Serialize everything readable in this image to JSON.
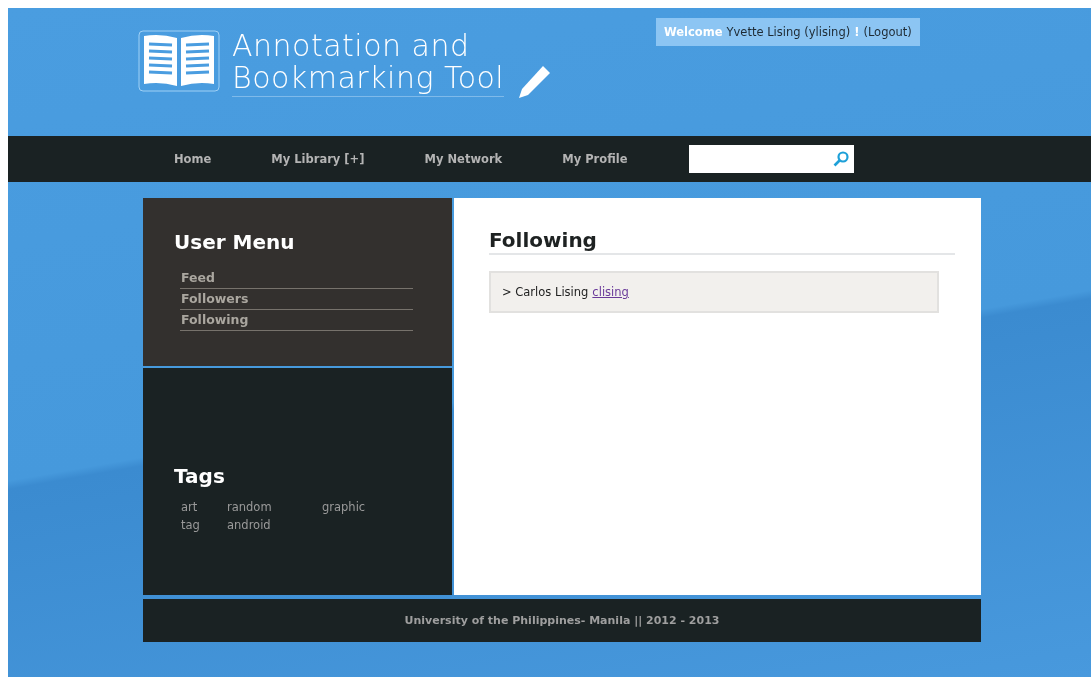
{
  "logo": {
    "title_lines": [
      "Annotation and",
      "Bookmarking Tool"
    ]
  },
  "welcome": {
    "greeting": "Welcome",
    "user": "Yvette Lising (ylising)",
    "mark": "!",
    "logout": "(Logout)"
  },
  "nav": {
    "items": [
      {
        "label": "Home"
      },
      {
        "label": "My Library [+]"
      },
      {
        "label": "My Network"
      },
      {
        "label": "My Profile"
      }
    ]
  },
  "user_menu": {
    "title": "User Menu",
    "items": [
      {
        "label": "Feed"
      },
      {
        "label": "Followers"
      },
      {
        "label": "Following"
      }
    ]
  },
  "tags": {
    "title": "Tags",
    "items": [
      "art",
      "random",
      "graphic",
      "tag",
      "android"
    ]
  },
  "main": {
    "title": "Following",
    "entries": [
      {
        "prefix": ">",
        "name": "Carlos Lising",
        "username": "clising"
      }
    ]
  },
  "footer": {
    "text": "University of the Philippines- Manila || 2012 - 2013"
  }
}
